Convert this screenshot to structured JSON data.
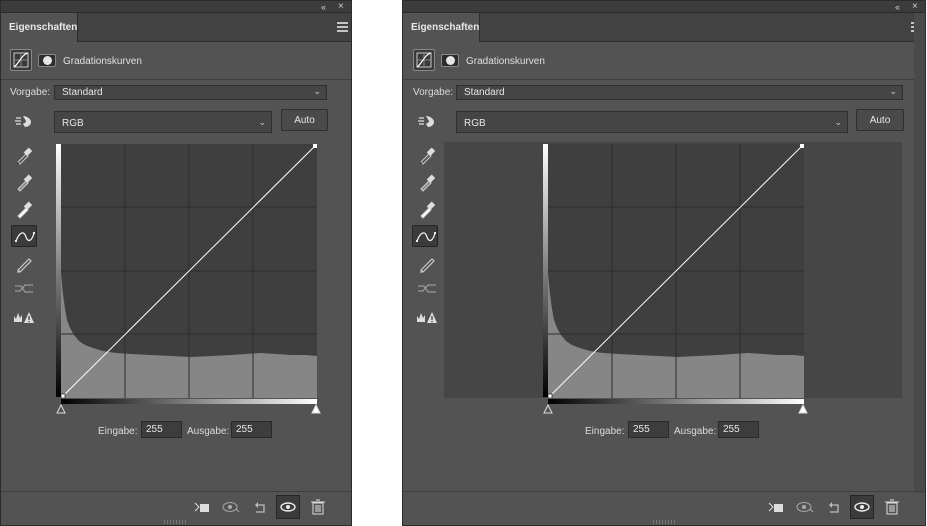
{
  "panels": [
    {
      "id": "left",
      "tab_label": "Eigenschaften",
      "adjustment_title": "Gradationskurven",
      "preset_label": "Vorgabe:",
      "preset_value": "Standard",
      "channel_value": "RGB",
      "auto_label": "Auto",
      "input_label": "Eingabe:",
      "input_value": "255",
      "output_label": "Ausgabe:",
      "output_value": "255"
    },
    {
      "id": "right",
      "tab_label": "Eigenschaften",
      "adjustment_title": "Gradationskurven",
      "preset_label": "Vorgabe:",
      "preset_value": "Standard",
      "channel_value": "RGB",
      "auto_label": "Auto",
      "input_label": "Eingabe:",
      "input_value": "255",
      "output_label": "Ausgabe:",
      "output_value": "255"
    }
  ],
  "colors": {
    "panel_bg": "#535353",
    "curve_bg": "#3f3f3f",
    "histogram": "#868686",
    "curve_line": "#ffffff"
  },
  "icons": {
    "collapse": "double-chevron-left-icon",
    "close": "close-icon",
    "menu": "panel-menu-icon",
    "tools": [
      "target-adjust-icon",
      "black-point-eyedropper-icon",
      "gray-point-eyedropper-icon",
      "white-point-eyedropper-icon",
      "curve-points-icon",
      "pencil-icon",
      "smooth-icon",
      "clipping-warning-icon"
    ],
    "bottom": [
      "clip-to-layer-icon",
      "view-previous-icon",
      "reset-icon",
      "visibility-eye-icon",
      "trash-icon"
    ]
  }
}
